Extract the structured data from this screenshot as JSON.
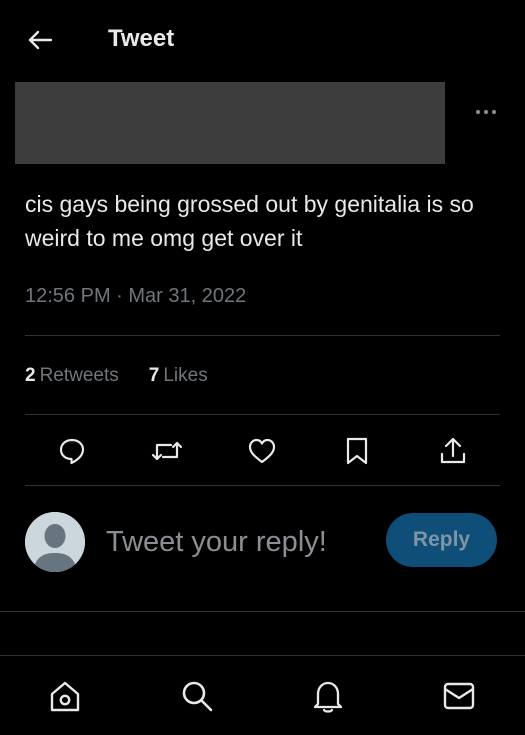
{
  "header": {
    "title": "Tweet"
  },
  "tweet": {
    "text": "cis gays being grossed out by genitalia is so weird to me omg get over it",
    "timestamp": "12:56 PM · Mar 31, 2022",
    "stats": {
      "retweets_count": "2",
      "retweets_label": "Retweets",
      "likes_count": "7",
      "likes_label": "Likes"
    }
  },
  "actions": [
    "reply",
    "retweet",
    "like",
    "bookmark",
    "share"
  ],
  "reply_box": {
    "placeholder": "Tweet your reply!",
    "button_label": "Reply"
  },
  "bottom_nav": [
    "home",
    "search",
    "notifications",
    "messages"
  ],
  "colors": {
    "background": "#000000",
    "text": "#e7e9ea",
    "muted": "#71767b",
    "divider": "#2f3336",
    "reply_button": "#0f4e78",
    "redaction": "#3c3c3c"
  }
}
